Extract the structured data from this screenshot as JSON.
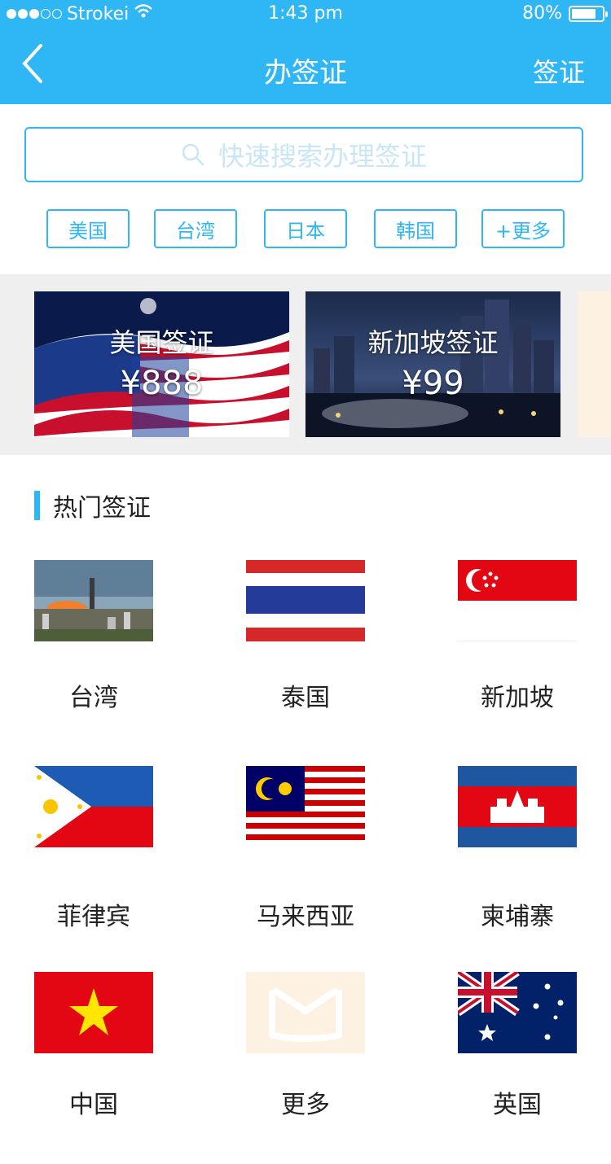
{
  "status_bar": {
    "carrier": "Strokei",
    "time": "1:43 pm",
    "battery": "80%",
    "battery_level": 0.8
  },
  "nav": {
    "title": "办签证",
    "right_label": "签证"
  },
  "search": {
    "placeholder": "快速搜索办理签证"
  },
  "quick_tags": [
    "美国",
    "台湾",
    "日本",
    "韩国",
    "+更多"
  ],
  "banners": [
    {
      "title": "美国签证",
      "price": "¥888"
    },
    {
      "title": "新加坡签证",
      "price": "¥99"
    }
  ],
  "section": {
    "title": "热门签证"
  },
  "hot_visas": [
    {
      "label": "台湾",
      "icon": "taiwan-photo"
    },
    {
      "label": "泰国",
      "icon": "thailand-flag"
    },
    {
      "label": "新加坡",
      "icon": "singapore-flag"
    },
    {
      "label": "菲律宾",
      "icon": "philippines-flag"
    },
    {
      "label": "马来西亚",
      "icon": "malaysia-flag"
    },
    {
      "label": "柬埔寨",
      "icon": "cambodia-flag"
    },
    {
      "label": "中国",
      "icon": "vietnam-flag"
    },
    {
      "label": "更多",
      "icon": "more-icon"
    },
    {
      "label": "英国",
      "icon": "australia-flag"
    }
  ],
  "colors": {
    "primary": "#2fb6f5",
    "banner_bg": "#efefef",
    "peek": "#fdf1e2"
  }
}
